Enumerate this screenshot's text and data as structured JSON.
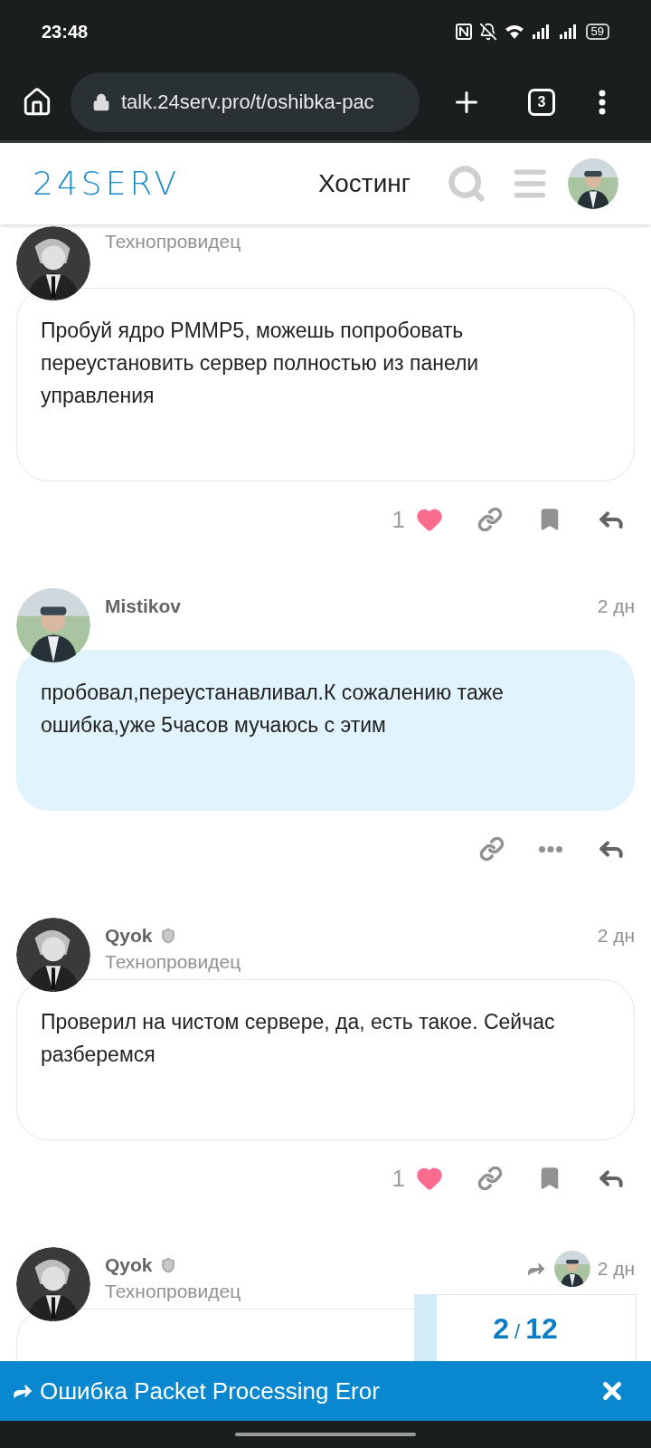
{
  "status_bar": {
    "time": "23:48",
    "battery": "59"
  },
  "browser": {
    "url": "talk.24serv.pro/t/oshibka-pac",
    "tab_count": "3"
  },
  "header": {
    "logo": "24SERV",
    "nav_label": "Хостинг"
  },
  "posts": [
    {
      "avatar": {
        "kind": "character"
      },
      "title": "Технопровидец",
      "moderator": false,
      "reply_to": false,
      "own": false,
      "text": "Пробуй ядро PMMP5, можешь попробовать переустановить сервер полностью из панели управления",
      "actions": [
        {
          "kind": "like",
          "count": "1",
          "liked": true
        },
        {
          "kind": "link"
        },
        {
          "kind": "bookmark"
        },
        {
          "kind": "reply"
        }
      ]
    },
    {
      "avatar": {
        "kind": "person"
      },
      "name": "Mistikov",
      "moderator": false,
      "date": "2 дн",
      "reply_to": false,
      "own": true,
      "text": "пробовал,переустанавливал.К сожалению таже ошибка,уже 5часов мучаюсь с этим",
      "actions": [
        {
          "kind": "link"
        },
        {
          "kind": "more"
        },
        {
          "kind": "reply"
        }
      ]
    },
    {
      "avatar": {
        "kind": "character"
      },
      "name": "Qyok",
      "title": "Технопровидец",
      "moderator": true,
      "date": "2 дн",
      "reply_to": false,
      "own": false,
      "text": "Проверил на чистом сервере, да, есть такое. Сейчас разберемся",
      "actions": [
        {
          "kind": "like",
          "count": "1",
          "liked": true
        },
        {
          "kind": "link"
        },
        {
          "kind": "bookmark"
        },
        {
          "kind": "reply"
        }
      ]
    },
    {
      "avatar": {
        "kind": "character"
      },
      "name": "Qyok",
      "title": "Технопровидец",
      "moderator": true,
      "date": "2 дн",
      "reply_to": true,
      "own": false
    }
  ],
  "progress": {
    "current": "2",
    "separator": "/",
    "total": "12",
    "level": 0.1
  },
  "banner": {
    "title": "Ошибка Packet Processing Eror"
  }
}
